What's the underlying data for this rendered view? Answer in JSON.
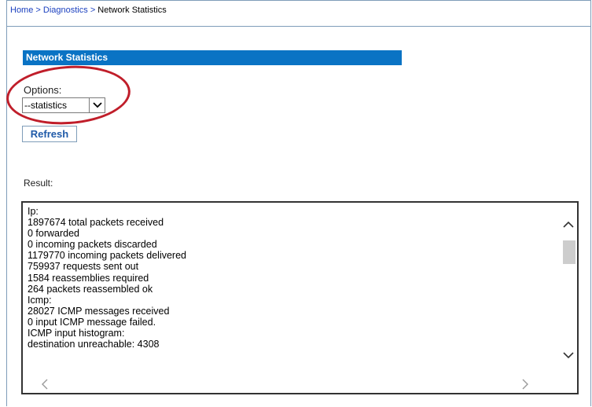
{
  "breadcrumb": {
    "items": [
      "Home",
      "Diagnostics",
      "Network Statistics"
    ],
    "separator": ">"
  },
  "section": {
    "title": "Network Statistics"
  },
  "options": {
    "label": "Options:",
    "selected": "--statistics"
  },
  "refresh_label": "Refresh",
  "result": {
    "label": "Result:",
    "lines": [
      "Ip:",
      "1897674 total packets received",
      "0 forwarded",
      "0 incoming packets discarded",
      "1179770 incoming packets delivered",
      "759937 requests sent out",
      "1584 reassemblies required",
      "264 packets reassembled ok",
      "Icmp:",
      "28027 ICMP messages received",
      "0 input ICMP message failed.",
      "ICMP input histogram:",
      "destination unreachable: 4308"
    ]
  },
  "colors": {
    "section_bar": "#0a73c4",
    "link": "#1a3fbf",
    "highlight": "#c01e2a"
  },
  "icons": {
    "select_arrow": "chevron-down-icon",
    "scroll_up": "chevron-up-icon",
    "scroll_down": "chevron-down-icon",
    "scroll_left": "chevron-left-icon",
    "scroll_right": "chevron-right-icon"
  }
}
